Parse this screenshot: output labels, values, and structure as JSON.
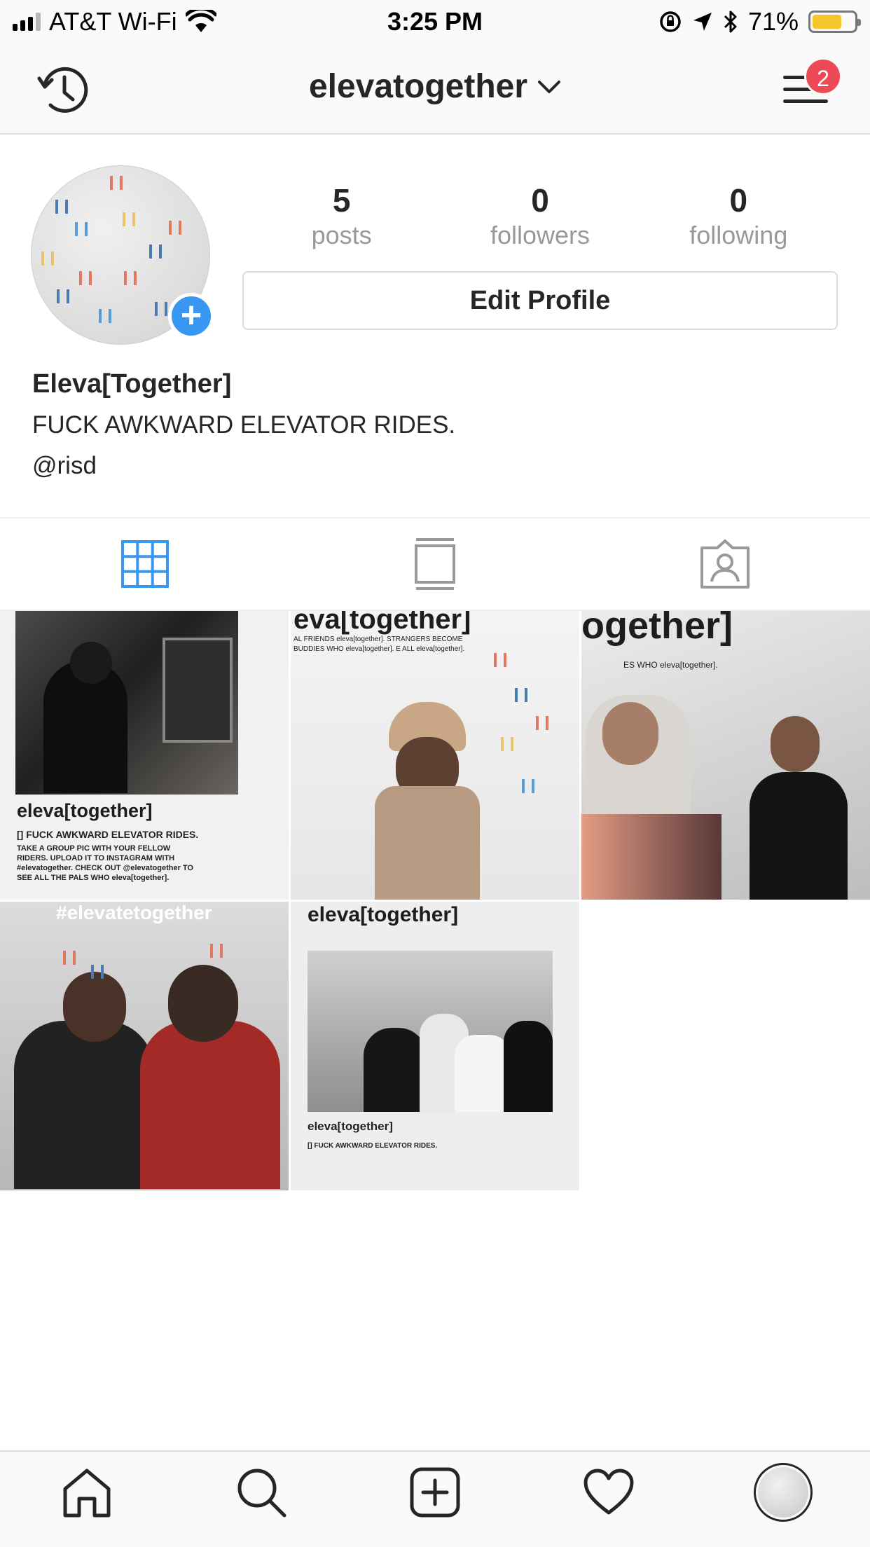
{
  "status_bar": {
    "carrier": "AT&T Wi-Fi",
    "time": "3:25 PM",
    "battery_percent": "71%",
    "battery_level": 0.71,
    "icons": [
      "signal-icon",
      "wifi-icon",
      "orientation-lock-icon",
      "location-icon",
      "bluetooth-icon",
      "battery-icon"
    ]
  },
  "nav": {
    "username": "elevatogether",
    "notification_count": "2",
    "icons": [
      "history-icon",
      "chevron-down-icon",
      "menu-icon"
    ]
  },
  "profile": {
    "stats": [
      {
        "value": "5",
        "label": "posts"
      },
      {
        "value": "0",
        "label": "followers"
      },
      {
        "value": "0",
        "label": "following"
      }
    ],
    "edit_button": "Edit Profile",
    "name": "Eleva[Together]",
    "bio": "FUCK AWKWARD ELEVATOR RIDES.",
    "link": "@risd"
  },
  "tabs": [
    {
      "icon": "grid-icon",
      "active": true
    },
    {
      "icon": "feed-icon",
      "active": false
    },
    {
      "icon": "tagged-icon",
      "active": false
    }
  ],
  "posts": [
    {
      "caption_title": "eleva[together]",
      "caption_line": "[] FUCK AWKWARD ELEVATOR RIDES.",
      "caption_body": "TAKE A GROUP PIC WITH YOUR FELLOW RIDERS. UPLOAD IT TO INSTAGRAM WITH #elevatogether. CHECK OUT @elevatogether TO SEE ALL THE PALS WHO eleva[together]."
    },
    {
      "caption_title": "eva[together]",
      "caption_line": "AL FRIENDS eleva[together]. STRANGERS BECOME BUDDIES WHO eleva[together]. E ALL eleva[together]."
    },
    {
      "caption_title": "ogether]",
      "caption_line": "ES WHO eleva[together]."
    },
    {
      "caption_title": "#elevatetogether"
    },
    {
      "caption_title": "eleva[together]",
      "caption_line": "eleva[together]",
      "caption_body": "[] FUCK AWKWARD ELEVATOR RIDES."
    }
  ],
  "tab_bar": {
    "items": [
      "home-icon",
      "search-icon",
      "add-post-icon",
      "activity-heart-icon",
      "profile-avatar"
    ]
  },
  "colors": {
    "accent": "#3897f0",
    "badge": "#ed4956",
    "muted": "#999999",
    "battery": "#f5c52c"
  }
}
